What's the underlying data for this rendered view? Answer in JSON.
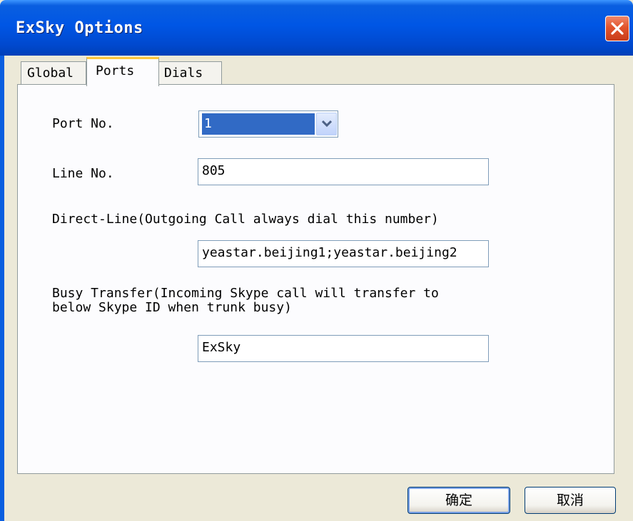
{
  "window": {
    "title": "ExSky Options",
    "close_icon": "close-icon"
  },
  "tabs": [
    {
      "label": "Global",
      "selected": false
    },
    {
      "label": "Ports",
      "selected": true
    },
    {
      "label": "Dials",
      "selected": false
    }
  ],
  "form": {
    "port_no_label": "Port No.",
    "port_no_value": "1",
    "line_no_label": "Line No.",
    "line_no_value": "805",
    "direct_line_label": "Direct-Line(Outgoing Call always dial this number)",
    "direct_line_value": "yeastar.beijing1;yeastar.beijing2",
    "busy_transfer_label_line1": "Busy Transfer(Incoming Skype call will transfer to",
    "busy_transfer_label_line2": "below Skype ID when trunk busy)",
    "busy_transfer_value": "ExSky"
  },
  "buttons": {
    "ok_label": "确定",
    "cancel_label": "取消"
  },
  "colors": {
    "titlebar": "#0056e5",
    "selection": "#316ac5",
    "tab_highlight": "#ffc83c",
    "close_button": "#e2542c"
  }
}
